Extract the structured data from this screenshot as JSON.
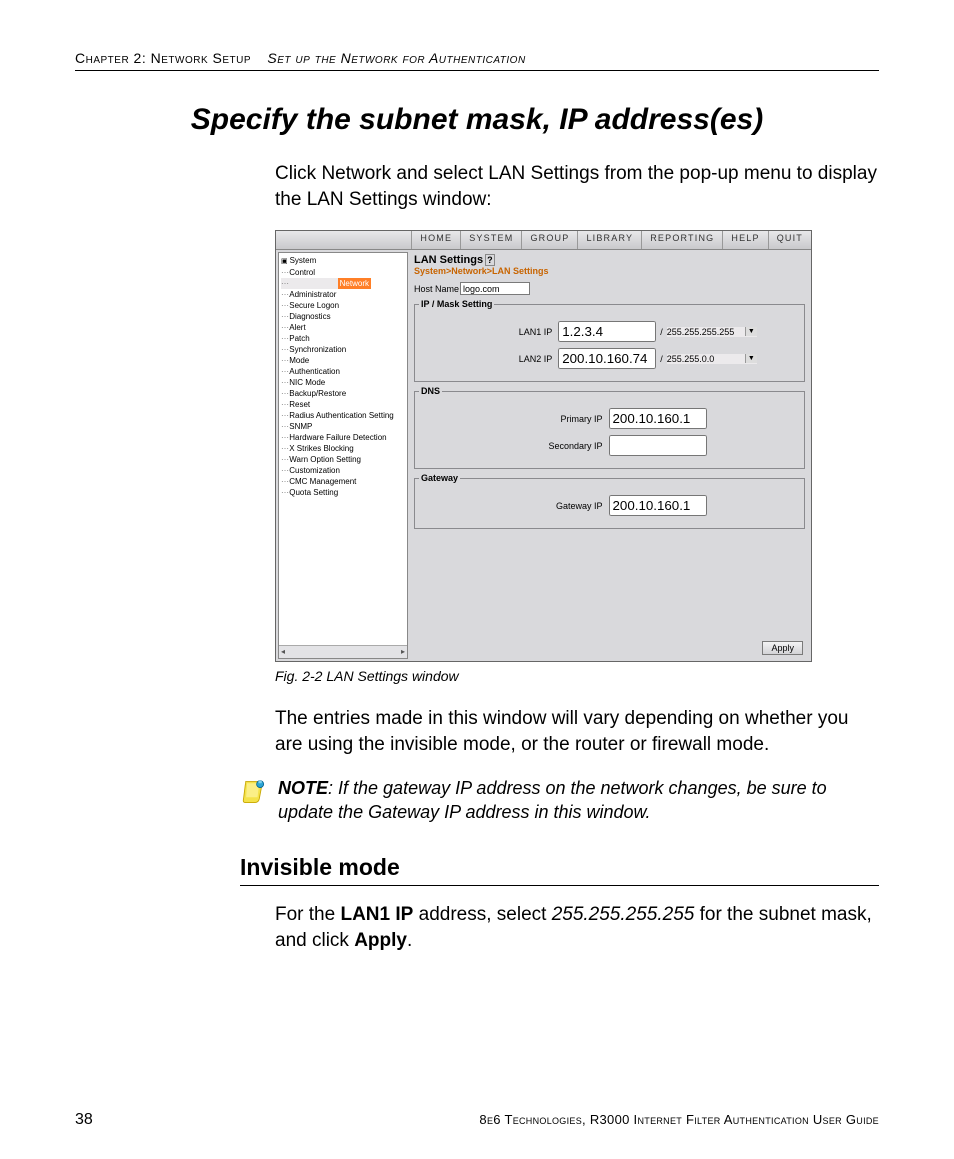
{
  "header": {
    "chapter": "Chapter 2: Network Setup",
    "section": "Set up the Network for Authentication"
  },
  "title": "Specify the subnet mask, IP address(es)",
  "intro": "Click Network and select LAN Settings from the pop-up menu to display the LAN Settings window:",
  "figure_caption": "Fig. 2-2  LAN Settings window",
  "body2": "The entries made in this window will vary depending on whether you are using the invisible mode, or the router or firewall mode.",
  "note_label": "NOTE",
  "note_text": ": If the gateway IP address on the network changes, be sure to update the Gateway IP address in this window.",
  "sub_heading": "Invisible mode",
  "sub_body_pre": "For the ",
  "sub_body_b1": "LAN1 IP",
  "sub_body_mid": " address, select ",
  "sub_body_i1": "255.255.255.255",
  "sub_body_mid2": " for the subnet mask, and click ",
  "sub_body_b2": "Apply",
  "sub_body_end": ".",
  "footer": {
    "page": "38",
    "book": "8e6 Technologies, R3000 Internet Filter Authentication User Guide"
  },
  "screenshot": {
    "menubar": [
      "HOME",
      "SYSTEM",
      "GROUP",
      "LIBRARY",
      "REPORTING",
      "HELP",
      "QUIT"
    ],
    "tree_root": "System",
    "tree_items": [
      "Control",
      "Network",
      "Administrator",
      "Secure Logon",
      "Diagnostics",
      "Alert",
      "Patch",
      "Synchronization",
      "Mode",
      "Authentication",
      "NIC Mode",
      "Backup/Restore",
      "Reset",
      "Radius Authentication Setting",
      "SNMP",
      "Hardware Failure Detection",
      "X Strikes Blocking",
      "Warn Option Setting",
      "Customization",
      "CMC Management",
      "Quota Setting"
    ],
    "tree_selected_index": 1,
    "panel_title": "LAN Settings",
    "breadcrumb": "System>Network>LAN Settings",
    "hostname_label": "Host Name",
    "hostname_value": "logo.com",
    "ipmask_legend": "IP / Mask Setting",
    "lan1_label": "LAN1 IP",
    "lan1_ip": "1.2.3.4",
    "lan1_mask": "255.255.255.255",
    "lan2_label": "LAN2 IP",
    "lan2_ip": "200.10.160.74",
    "lan2_mask": "255.255.0.0",
    "dns_legend": "DNS",
    "primary_label": "Primary IP",
    "primary_ip": "200.10.160.1",
    "secondary_label": "Secondary IP",
    "secondary_ip": "",
    "gateway_legend": "Gateway",
    "gateway_label": "Gateway IP",
    "gateway_ip": "200.10.160.1",
    "apply_label": "Apply"
  }
}
